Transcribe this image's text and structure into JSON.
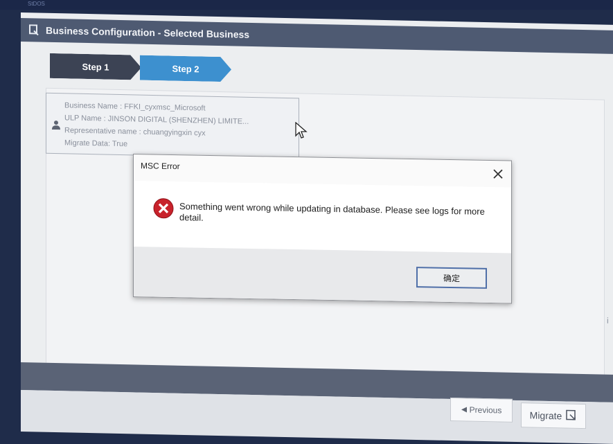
{
  "topbar": {
    "label": "StDOS"
  },
  "window": {
    "title": "Business Configuration - Selected Business"
  },
  "steps": [
    {
      "label": "Step 1"
    },
    {
      "label": "Step 2"
    }
  ],
  "info": {
    "business_name": "Business Name : FFKI_cyxmsc_Microsoft",
    "ulp_name": "ULP Name : JINSON DIGITAL (SHENZHEN) LIMITE...",
    "representative": "Representative name : chuangyingxin cyx",
    "migrate_data": "Migrate Data: True"
  },
  "dialog": {
    "title": "MSC Error",
    "message": "Something went wrong while updating in database. Please see logs for more detail.",
    "ok_label": "确定"
  },
  "footer": {
    "previous_label": "Previous",
    "migrate_label": "Migrate"
  },
  "side_glyph": "i",
  "colors": {
    "titlebar": "#4e5a72",
    "step_inactive": "#3c4354",
    "step_active": "#3d90cf",
    "error_red": "#c8222b"
  },
  "icons": {
    "app": "app-logo-icon",
    "person": "person-icon",
    "close": "close-icon",
    "error": "error-icon",
    "previous": "arrow-left-icon",
    "migrate": "migrate-icon",
    "cursor": "mouse-cursor-icon"
  }
}
